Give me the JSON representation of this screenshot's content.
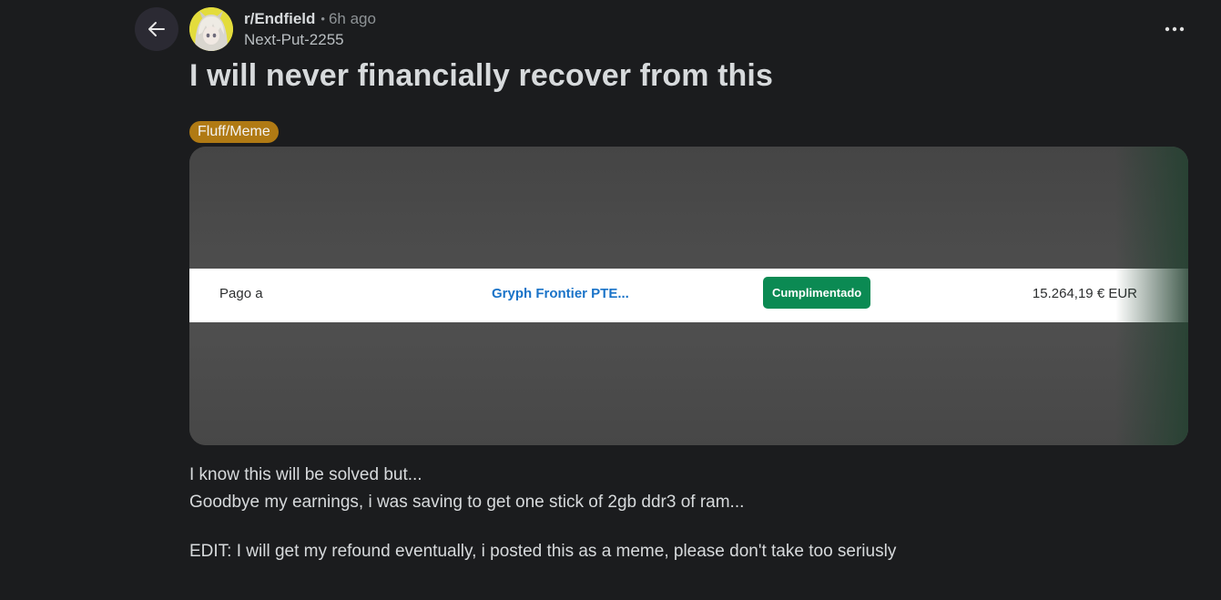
{
  "post": {
    "subreddit": "r/Endfield",
    "time_ago": "6h ago",
    "author": "Next-Put-2255",
    "title": "I will never financially recover from this",
    "flair": "Fluff/Meme",
    "body_lines": [
      "I know this will be solved but...",
      "Goodbye my earnings, i was saving to get one stick of 2gb ddr3 of ram..."
    ],
    "edit_line": "EDIT: I will get my refound eventually, i posted this as a meme, please don't take too seriusly"
  },
  "receipt": {
    "label": "Pago a",
    "merchant": "Gryph Frontier PTE...",
    "status": "Cumplimentado",
    "amount": "15.264,19 € EUR"
  },
  "icons": {
    "back": "arrow-left-icon",
    "more": "more-horizontal-icon"
  },
  "colors": {
    "background": "#1b1c1e",
    "flair_bg": "#b07a14",
    "status_green": "#0b8a53",
    "merchant_link": "#1a73c8"
  }
}
